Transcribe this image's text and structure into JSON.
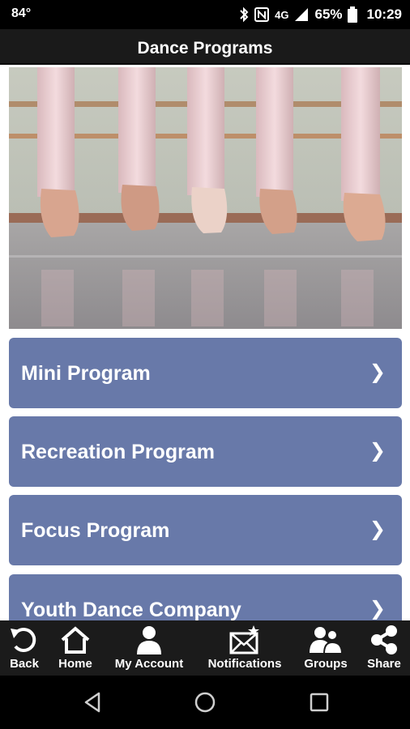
{
  "status_bar": {
    "temperature": "84°",
    "network": "4G",
    "battery": "65%",
    "time": "10:29"
  },
  "header": {
    "title": "Dance Programs"
  },
  "hero": {
    "image": "ballet-dancers-feet-photo"
  },
  "menu": [
    {
      "label": "Mini Program",
      "chevron": "❯"
    },
    {
      "label": "Recreation Program",
      "chevron": "❯"
    },
    {
      "label": "Focus Program",
      "chevron": "❯"
    },
    {
      "label": "Youth Dance Company",
      "chevron": "❯"
    }
  ],
  "tabs": [
    {
      "label": "Back",
      "icon": "back-arrow-icon"
    },
    {
      "label": "Home",
      "icon": "home-icon"
    },
    {
      "label": "My Account",
      "icon": "person-icon"
    },
    {
      "label": "Notifications",
      "icon": "envelope-star-icon"
    },
    {
      "label": "Groups",
      "icon": "group-icon"
    },
    {
      "label": "Share",
      "icon": "share-icon"
    }
  ],
  "colors": {
    "menu_item_bg": "#6879a9",
    "title_bar_bg": "#1a1a1a",
    "tab_bar_bg": "#1b1b1b"
  }
}
